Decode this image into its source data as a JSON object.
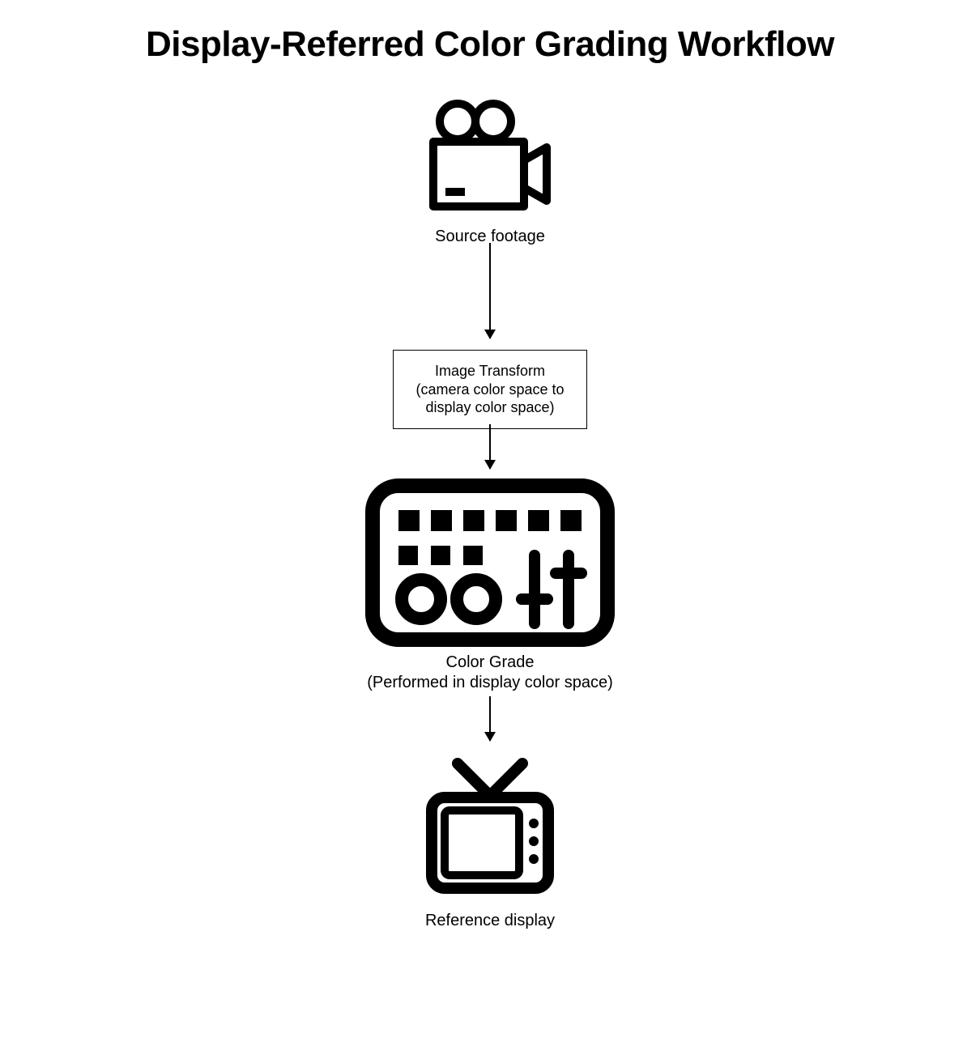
{
  "title": "Display-Referred Color Grading Workflow",
  "nodes": {
    "source": {
      "label": "Source footage"
    },
    "transform": {
      "line1": "Image Transform",
      "line2": "(camera color space to",
      "line3": "display color space)"
    },
    "grade": {
      "line1": "Color Grade",
      "line2": "(Performed in display color space)"
    },
    "display": {
      "label": "Reference display"
    }
  }
}
